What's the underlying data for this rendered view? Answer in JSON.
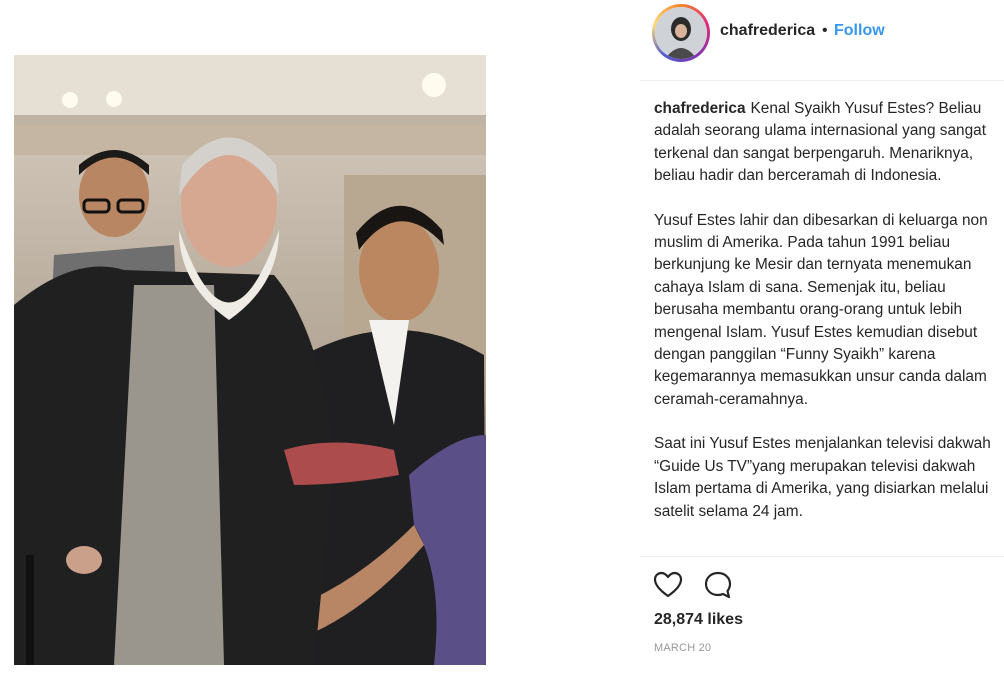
{
  "post": {
    "image_alt": "",
    "header": {
      "username": "chafrederica",
      "separator": "•",
      "follow_label": "Follow"
    },
    "caption": {
      "username": "chafrederica",
      "paragraphs": [
        "Kenal Syaikh Yusuf Estes? Beliau adalah seorang ulama internasional yang sangat terkenal dan sangat berpengaruh. Menariknya, beliau hadir dan berceramah di Indonesia.",
        "Yusuf Estes lahir dan dibesarkan di keluarga non muslim di Amerika. Pada tahun 1991 beliau berkunjung ke Mesir dan ternyata menemukan cahaya Islam di sana. Semenjak itu, beliau berusaha membantu orang-orang untuk lebih mengenal Islam. Yusuf Estes kemudian disebut dengan panggilan “Funny Syaikh” karena kegemarannya memasukkan unsur canda dalam ceramah-ceramahnya.",
        "Saat ini Yusuf Estes menjalankan televisi dakwah “Guide Us TV”yang merupakan televisi dakwah Islam pertama di Amerika, yang disiarkan melalui satelit selama 24 jam."
      ]
    },
    "actions": {
      "like_icon": "heart-outline-icon",
      "comment_icon": "comment-bubble-icon"
    },
    "likes": "28,874 likes",
    "date": "MARCH 20"
  },
  "colors": {
    "follow": "#3897f0",
    "text": "#262626",
    "muted": "#999999",
    "divider": "#efefef"
  }
}
